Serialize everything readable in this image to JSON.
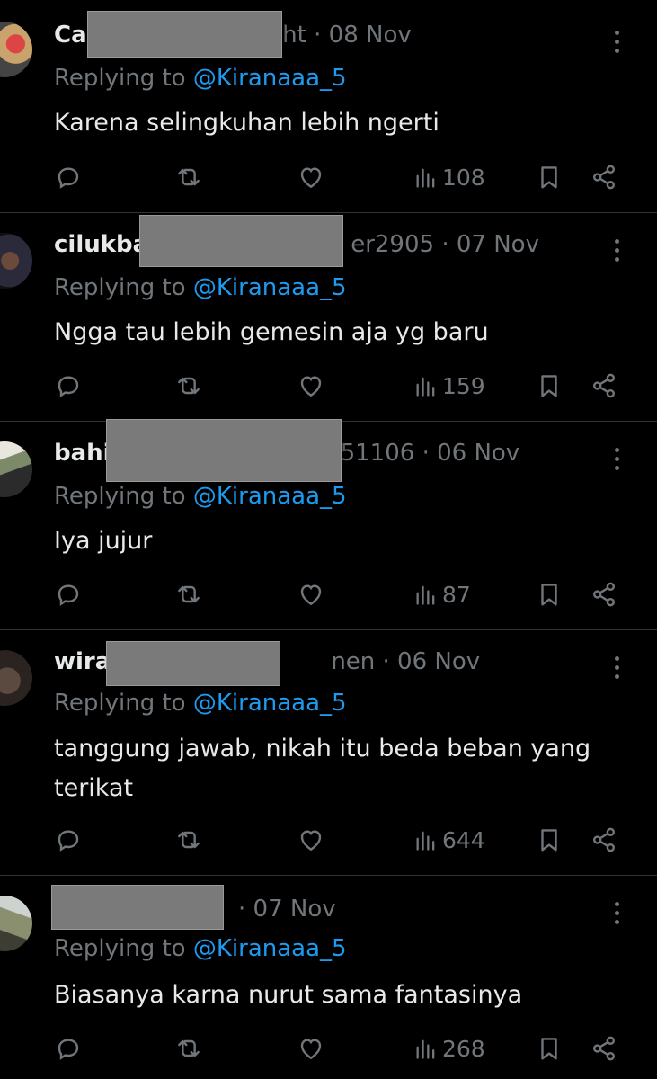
{
  "tweets": [
    {
      "name": "Ca",
      "handle_tail": "sht",
      "date": "· 08 Nov",
      "reply_prefix": "Replying to",
      "mention": "@Kiranaaa_5",
      "text": "Karena selingkuhan lebih ngerti",
      "views": "108"
    },
    {
      "name": "cilukba",
      "handle_tail": "er2905",
      "date": "· 07 Nov",
      "reply_prefix": "Replying to",
      "mention": "@Kiranaaa_5",
      "text": "Ngga tau lebih gemesin aja yg baru",
      "views": "159"
    },
    {
      "name": "bahi",
      "handle_tail": "51106",
      "date": "· 06 Nov",
      "reply_prefix": "Replying to",
      "mention": "@Kiranaaa_5",
      "text": "Iya jujur",
      "views": "87"
    },
    {
      "name": "wira",
      "handle_tail": "nen",
      "date": "· 06 Nov",
      "reply_prefix": "Replying to",
      "mention": "@Kiranaaa_5",
      "text": "tanggung jawab, nikah itu beda beban yang terikat",
      "views": "644"
    },
    {
      "name": "",
      "handle_tail": "",
      "date": "· 07 Nov",
      "reply_prefix": "Replying to",
      "mention": "@Kiranaaa_5",
      "text": "Biasanya karna nurut sama fantasinya",
      "views": "268"
    }
  ],
  "icons": {
    "reply": "reply-icon",
    "retweet": "retweet-icon",
    "like": "heart-icon",
    "views": "views-icon",
    "bookmark": "bookmark-icon",
    "share": "share-icon",
    "more": "more-icon"
  },
  "colors": {
    "background": "#000000",
    "text": "#e7e9ea",
    "muted": "#71767b",
    "mention": "#1d9bf0",
    "divider": "#2f3336",
    "redaction": "#7a7a7a"
  }
}
